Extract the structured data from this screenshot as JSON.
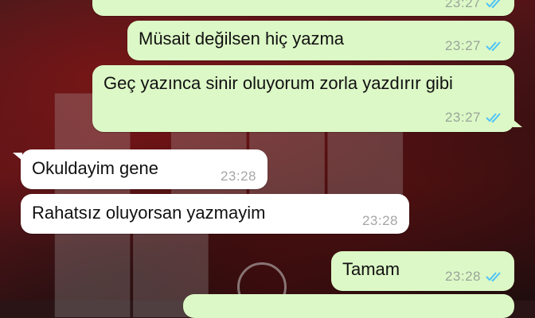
{
  "messages": [
    {
      "direction": "out",
      "text": "",
      "time": "23:27",
      "status_icon": "read-double-check-icon"
    },
    {
      "direction": "out",
      "text": "Müsait değilsen hiç yazma",
      "time": "23:27",
      "status_icon": "read-double-check-icon"
    },
    {
      "direction": "out",
      "text": "Geç yazınca sinir oluyorum zorla yazdırır gibi",
      "time": "23:27",
      "status_icon": "read-double-check-icon"
    },
    {
      "direction": "in",
      "text": "Okuldayim gene",
      "time": "23:28"
    },
    {
      "direction": "in",
      "text": "Rahatsız oluyorsan yazmayim",
      "time": "23:28"
    },
    {
      "direction": "out",
      "text": "Tamam",
      "time": "23:28",
      "status_icon": "read-double-check-icon"
    },
    {
      "direction": "out",
      "text": "",
      "time": ""
    }
  ],
  "colors": {
    "outgoing_bubble": "#dcf8c6",
    "incoming_bubble": "#ffffff",
    "read_ticks": "#4fc3f7",
    "timestamp": "#9aa59a"
  },
  "wallpaper": {
    "style": "dark red poster"
  }
}
